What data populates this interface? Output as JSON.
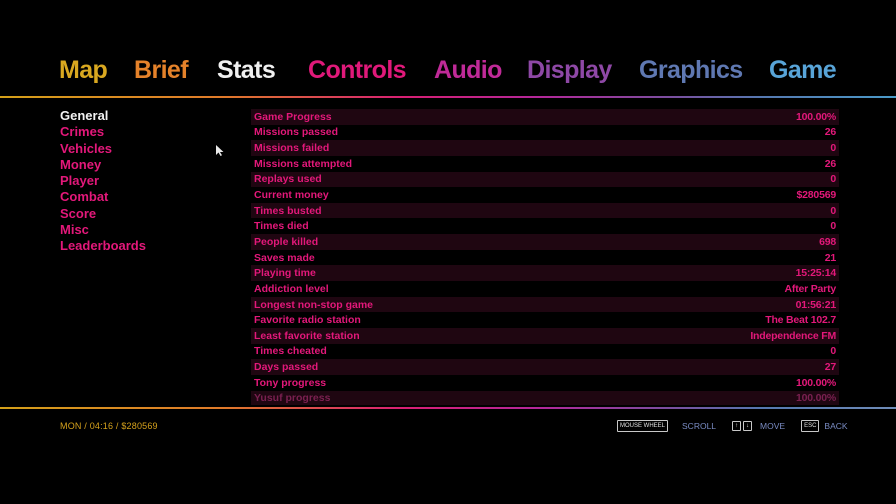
{
  "tabs": [
    {
      "label": "Map",
      "color": "#d9a820"
    },
    {
      "label": "Brief",
      "color": "#e5822a"
    },
    {
      "label": "Stats",
      "color": "#f0f0f0"
    },
    {
      "label": "Controls",
      "color": "#e0197a"
    },
    {
      "label": "Audio",
      "color": "#c02a98"
    },
    {
      "label": "Display",
      "color": "#8e48a6"
    },
    {
      "label": "Graphics",
      "color": "#5f78b2"
    },
    {
      "label": "Game",
      "color": "#58a4d8"
    }
  ],
  "active_tab": "Stats",
  "categories": [
    {
      "label": "General",
      "active": true
    },
    {
      "label": "Crimes"
    },
    {
      "label": "Vehicles"
    },
    {
      "label": "Money"
    },
    {
      "label": "Player"
    },
    {
      "label": "Combat"
    },
    {
      "label": "Score"
    },
    {
      "label": "Misc"
    },
    {
      "label": "Leaderboards"
    }
  ],
  "stats": [
    {
      "label": "Game Progress",
      "value": "100.00%"
    },
    {
      "label": "Missions passed",
      "value": "26"
    },
    {
      "label": "Missions failed",
      "value": "0"
    },
    {
      "label": "Missions attempted",
      "value": "26"
    },
    {
      "label": "Replays used",
      "value": "0"
    },
    {
      "label": "Current money",
      "value": "$280569"
    },
    {
      "label": "Times busted",
      "value": "0"
    },
    {
      "label": "Times died",
      "value": "0"
    },
    {
      "label": "People killed",
      "value": "698"
    },
    {
      "label": "Saves made",
      "value": "21"
    },
    {
      "label": "Playing time",
      "value": "15:25:14"
    },
    {
      "label": "Addiction level",
      "value": "After Party"
    },
    {
      "label": "Longest non-stop game",
      "value": "01:56:21"
    },
    {
      "label": "Favorite radio station",
      "value": "The Beat 102.7"
    },
    {
      "label": "Least favorite station",
      "value": "Independence FM"
    },
    {
      "label": "Times cheated",
      "value": "0"
    },
    {
      "label": "Days passed",
      "value": "27"
    },
    {
      "label": "Tony progress",
      "value": "100.00%"
    },
    {
      "label": "Yusuf progress",
      "value": "100.00%"
    }
  ],
  "status_bar": {
    "text": "MON / 04:16 / $280569"
  },
  "hints": {
    "scroll_key": "MOUSE WHEEL",
    "scroll_label": "SCROLL",
    "up_key": "↑",
    "down_key": "↓",
    "move_label": "MOVE",
    "back_key": "ESC",
    "back_label": "BACK"
  }
}
